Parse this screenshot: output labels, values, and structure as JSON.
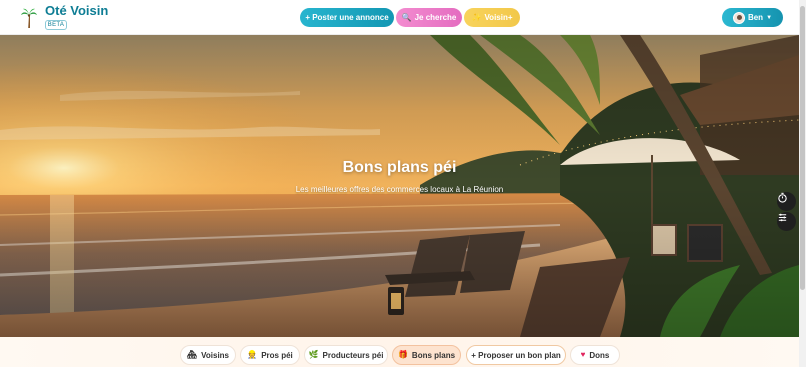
{
  "header": {
    "brand_name": "Oté Voisin",
    "brand_badge": "BETA",
    "post_button": "+ Poster une annonce",
    "search_button": "Je cherche",
    "voisin_plus_button": "Voisin+",
    "user_button": "Ben"
  },
  "hero": {
    "title": "Bons plans péi",
    "subtitle": "Les meilleures offres des commerces locaux à La Réunion"
  },
  "nav": {
    "voisins": "Voisins",
    "pros": "Pros péi",
    "producteurs": "Producteurs péi",
    "bons_plans": "Bons plans",
    "proposer": "+ Proposer un bon plan",
    "dons": "Dons"
  },
  "icons": {
    "search": "magnifier-icon",
    "voisin_plus": "sparkle-icon",
    "side_1": "stopwatch-icon",
    "side_2": "filter-icon"
  },
  "colors": {
    "primary": "#1397b3",
    "pink": "#e46cc0",
    "yellow": "#f2c84a",
    "active_tab": "#fde3cf"
  }
}
